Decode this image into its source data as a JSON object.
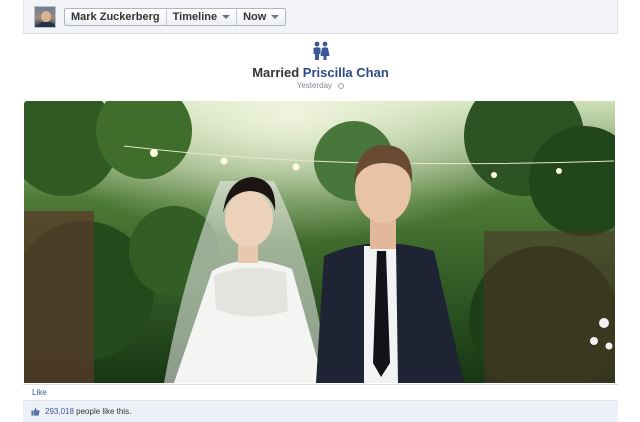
{
  "header": {
    "profile_name": "Mark Zuckerberg",
    "timeline_label": "Timeline",
    "period_label": "Now"
  },
  "story": {
    "icon": "married-couple-icon",
    "verb": "Married",
    "partner": "Priscilla Chan",
    "timestamp": "Yesterday",
    "privacy_icon": "globe-icon"
  },
  "photo": {
    "subject": "wedding-photo"
  },
  "actions": {
    "like_label": "Like"
  },
  "likes": {
    "count": "293,018",
    "suffix": "people like this.",
    "icon": "thumbs-up-icon"
  },
  "colors": {
    "link": "#3b5998",
    "name": "#2c4a86",
    "bar": "#f3f4f8",
    "likes_bar": "#edf0f6"
  }
}
